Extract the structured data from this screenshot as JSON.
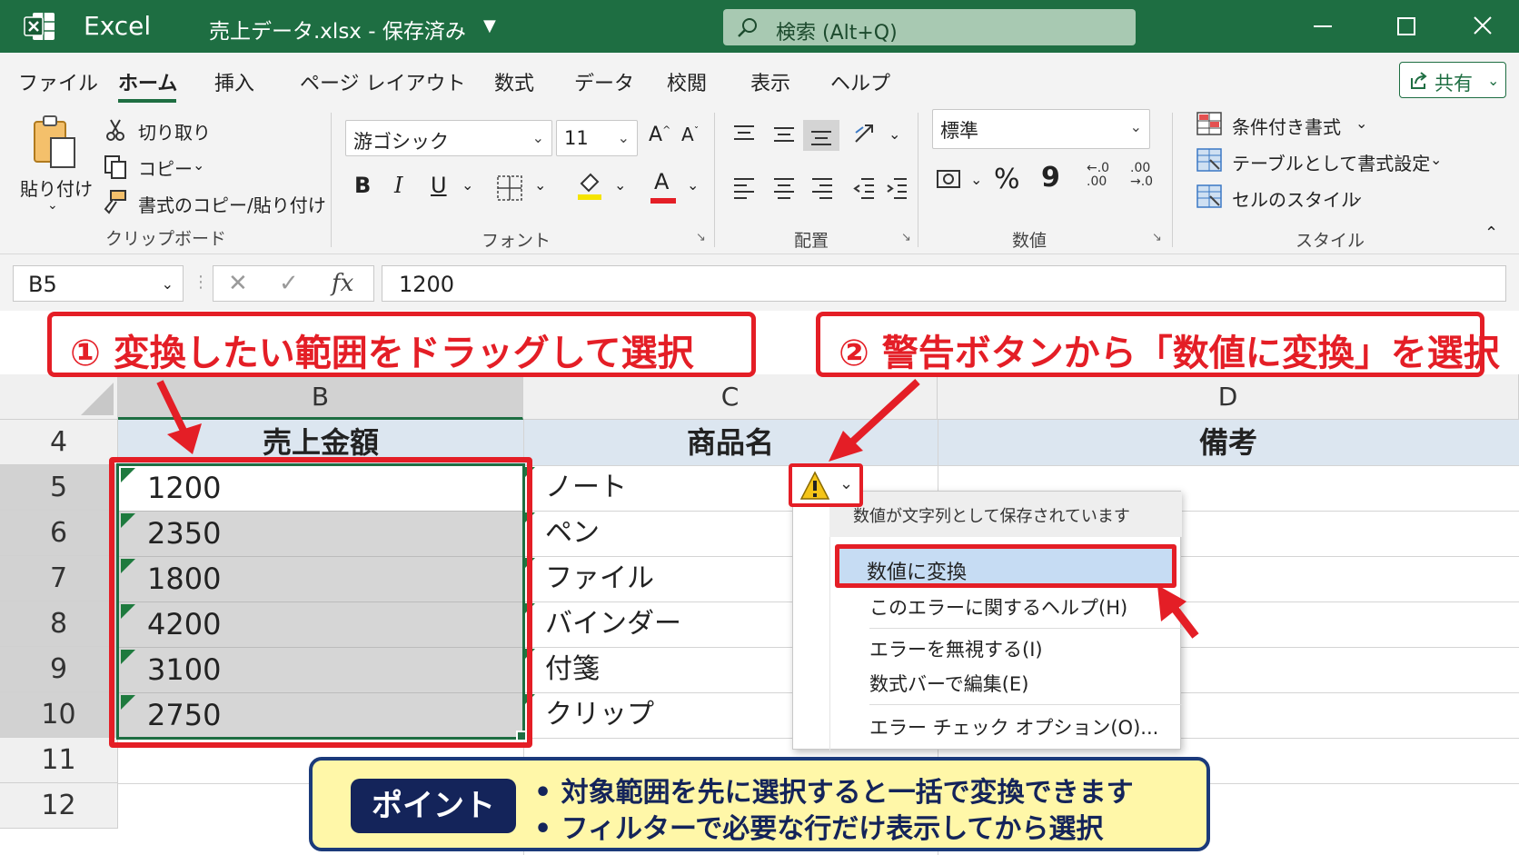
{
  "titlebar": {
    "app": "Excel",
    "file": "売上データ.xlsx  -  保存済み",
    "search_placeholder": "検索 (Alt+Q)"
  },
  "menu": {
    "items": [
      "ファイル",
      "ホーム",
      "挿入",
      "ページ レイアウト",
      "数式",
      "データ",
      "校閲",
      "表示",
      "ヘルプ"
    ],
    "active": "ホーム",
    "share": "共有"
  },
  "ribbon": {
    "clipboard": {
      "paste": "貼り付け",
      "cut": "切り取り",
      "copy": "コピー",
      "format_painter": "書式のコピー/貼り付け",
      "label": "クリップボード"
    },
    "font": {
      "name": "游ゴシック",
      "size": "11",
      "label": "フォント",
      "bold": "B",
      "italic": "I",
      "underline": "U",
      "grow": "A",
      "shrink": "A",
      "font_color": "A"
    },
    "alignment": {
      "label": "配置"
    },
    "number": {
      "format": "標準",
      "percent": "%",
      "comma": "9",
      "inc_decimal": "←.0 .00",
      "dec_decimal": ".00 →.0",
      "label": "数値"
    },
    "styles": {
      "conditional": "条件付き書式",
      "table": "テーブルとして書式設定",
      "cell": "セルのスタイル",
      "label": "スタイル"
    }
  },
  "formula_bar": {
    "name_box": "B5",
    "fx": "fx",
    "value": "1200"
  },
  "sheet": {
    "columns": [
      "B",
      "C",
      "D"
    ],
    "rows": [
      "4",
      "5",
      "6",
      "7",
      "8",
      "9",
      "10",
      "11",
      "12"
    ],
    "headers": {
      "B": "売上金額",
      "C": "商品名",
      "D": "備考"
    },
    "data": [
      {
        "b": "1200",
        "c": "ノート"
      },
      {
        "b": "2350",
        "c": "ペン"
      },
      {
        "b": "1800",
        "c": "ファイル"
      },
      {
        "b": "4200",
        "c": "バインダー"
      },
      {
        "b": "3100",
        "c": "付箋"
      },
      {
        "b": "2750",
        "c": "クリップ"
      }
    ]
  },
  "context_menu": {
    "header": "数値が文字列として保存されています",
    "items": [
      "数値に変換",
      "このエラーに関するヘルプ(H)",
      "エラーを無視する(I)",
      "数式バーで編集(E)",
      "エラー チェック オプション(O)..."
    ]
  },
  "annotations": {
    "step1": "① 変換したい範囲をドラッグして選択",
    "step2": "② 警告ボタンから「数値に変換」を選択",
    "point_badge": "ポイント",
    "point_lines": [
      "• 対象範囲を先に選択すると一括で変換できます",
      "• フィルターで必要な行だけ表示してから選択"
    ]
  },
  "colors": {
    "excel_green": "#1e6e42",
    "highlight_red": "#e41e26",
    "point_navy": "#14245a",
    "point_yellow": "#fff7a8"
  }
}
